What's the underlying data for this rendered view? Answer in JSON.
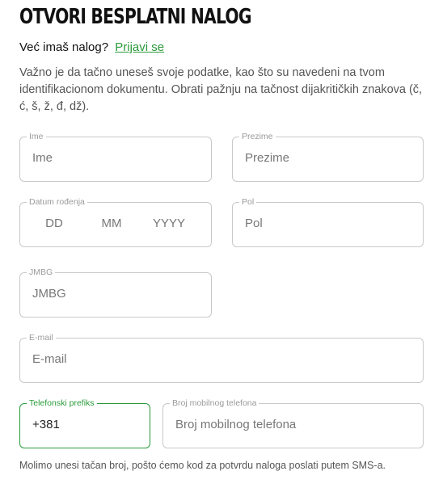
{
  "header": {
    "title": "OTVORI BESPLATNI NALOG"
  },
  "login": {
    "question": "Već imaš nalog?",
    "link": "Prijavi se"
  },
  "intro": "Važno je da tačno uneseš svoje podatke, kao što su navedeni na tvom identifikacionom dokumentu. Obrati pažnju na tačnost dijakritičkih znakova (č, ć, š, ž, đ, dž).",
  "fields": {
    "first_name": {
      "label": "Ime",
      "placeholder": "Ime"
    },
    "last_name": {
      "label": "Prezime",
      "placeholder": "Prezime"
    },
    "birth_date": {
      "label": "Datum rođenja",
      "day": "DD",
      "month": "MM",
      "year": "YYYY"
    },
    "gender": {
      "label": "Pol",
      "placeholder": "Pol"
    },
    "jmbg": {
      "label": "JMBG",
      "placeholder": "JMBG"
    },
    "email": {
      "label": "E-mail",
      "placeholder": "E-mail"
    },
    "phone_prefix": {
      "label": "Telefonski prefiks",
      "value": "+381"
    },
    "phone_number": {
      "label": "Broj mobilnog telefona",
      "placeholder": "Broj mobilnog telefona"
    }
  },
  "sms_note": "Molimo unesi tačan broj, pošto ćemo kod za potvrdu naloga poslati putem SMS-a.",
  "colors": {
    "accent": "#2a9a3a",
    "border": "#c9c9c9"
  }
}
